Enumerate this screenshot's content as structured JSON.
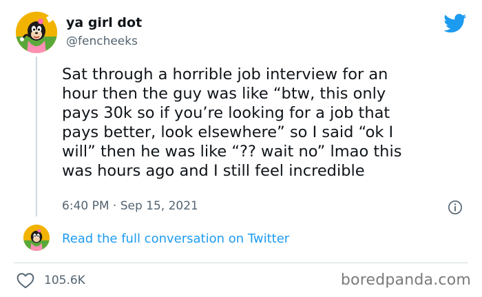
{
  "author": {
    "display_name": "ya girl dot",
    "handle": "@fencheeks"
  },
  "tweet": {
    "lines": [
      "Sat through a horrible job interview for an",
      "hour then the guy was like “btw, this only",
      "pays 30k so if you’re looking for a job that",
      "pays better, look elsewhere” so I said “ok I",
      "will” then he was like “?? wait no” lmao this",
      "was hours ago and I still feel incredible"
    ],
    "timestamp": "6:40 PM · Sep 15, 2021"
  },
  "conversation_link": "Read the full conversation on Twitter",
  "stats": {
    "likes": "105.6K"
  },
  "watermark": "boredpanda.com",
  "icons": {
    "brand": "twitter-bird-icon",
    "info": "info-icon",
    "like": "heart-icon"
  },
  "colors": {
    "accent": "#1d9bf0",
    "secondary_text": "#536471",
    "primary_text": "#0f1419",
    "avatar_bg": "#f1b300"
  }
}
